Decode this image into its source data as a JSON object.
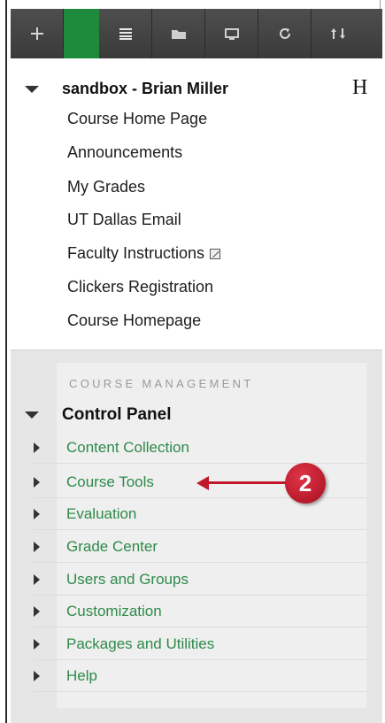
{
  "toolbar": {
    "buttons": [
      {
        "icon": "plus-icon"
      },
      {
        "icon": "list-icon"
      },
      {
        "icon": "folder-icon"
      },
      {
        "icon": "monitor-icon"
      },
      {
        "icon": "refresh-icon"
      },
      {
        "icon": "sort-icon"
      }
    ],
    "active_color": "#1e8a3c"
  },
  "course_menu": {
    "title": "sandbox - Brian Miller",
    "side_letter": "H",
    "links": [
      "Course Home Page",
      "Announcements",
      "My Grades",
      "UT Dallas Email",
      "Faculty Instructions",
      "Clickers Registration",
      "Course Homepage"
    ]
  },
  "course_management": {
    "header": "COURSE MANAGEMENT",
    "control_panel_label": "Control Panel",
    "items": [
      "Content Collection",
      "Course Tools",
      "Evaluation",
      "Grade Center",
      "Users and Groups",
      "Customization",
      "Packages and Utilities",
      "Help"
    ],
    "link_color": "#2e8a4a"
  },
  "annotation": {
    "badge_number": "2",
    "color": "#c0172b"
  }
}
